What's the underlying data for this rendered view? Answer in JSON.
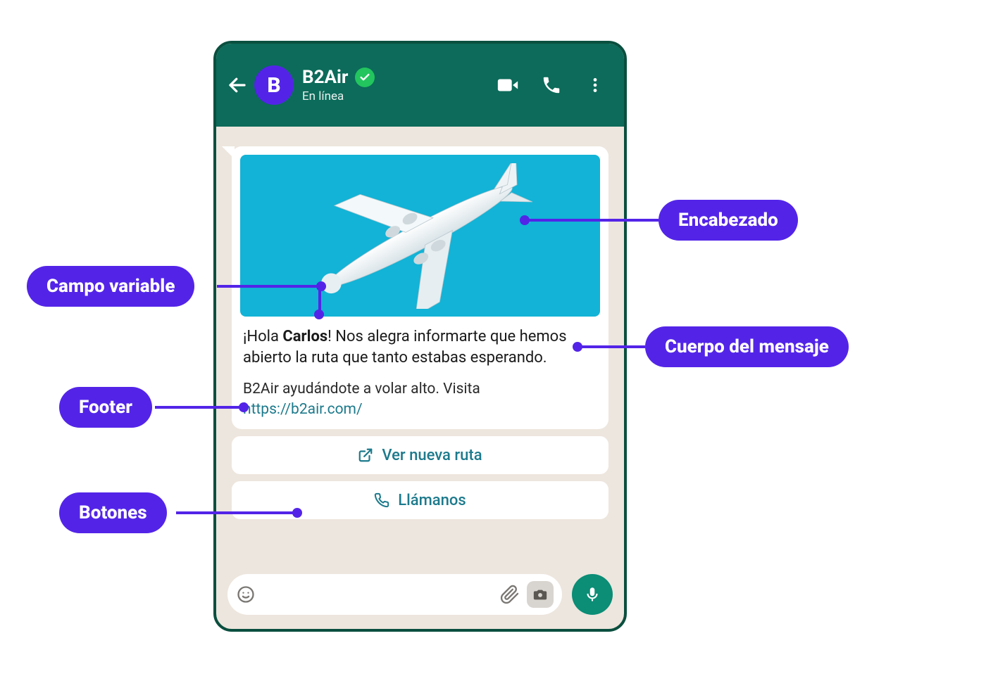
{
  "header": {
    "contact_name": "B2Air",
    "status": "En línea",
    "avatar_letter": "B"
  },
  "message": {
    "body_prefix": "¡Hola ",
    "body_variable": "Carlos",
    "body_suffix": "! Nos alegra informarte que hemos abierto la ruta que tanto estabas esperando.",
    "footer_text": "B2Air ayudándote a volar alto. Visita",
    "footer_link": "https://b2air.com/",
    "buttons": [
      "Ver nueva ruta",
      "Llámanos"
    ]
  },
  "annotations": {
    "encabezado": "Encabezado",
    "campo_variable": "Campo variable",
    "cuerpo": "Cuerpo del mensaje",
    "footer": "Footer",
    "botones": "Botones"
  },
  "colors": {
    "brand_purple": "#5324E8",
    "wa_green_dark": "#0c6b5a",
    "wa_teal": "#0b8d76",
    "link_teal": "#1c7a8c",
    "image_bg": "#12B3D6"
  }
}
